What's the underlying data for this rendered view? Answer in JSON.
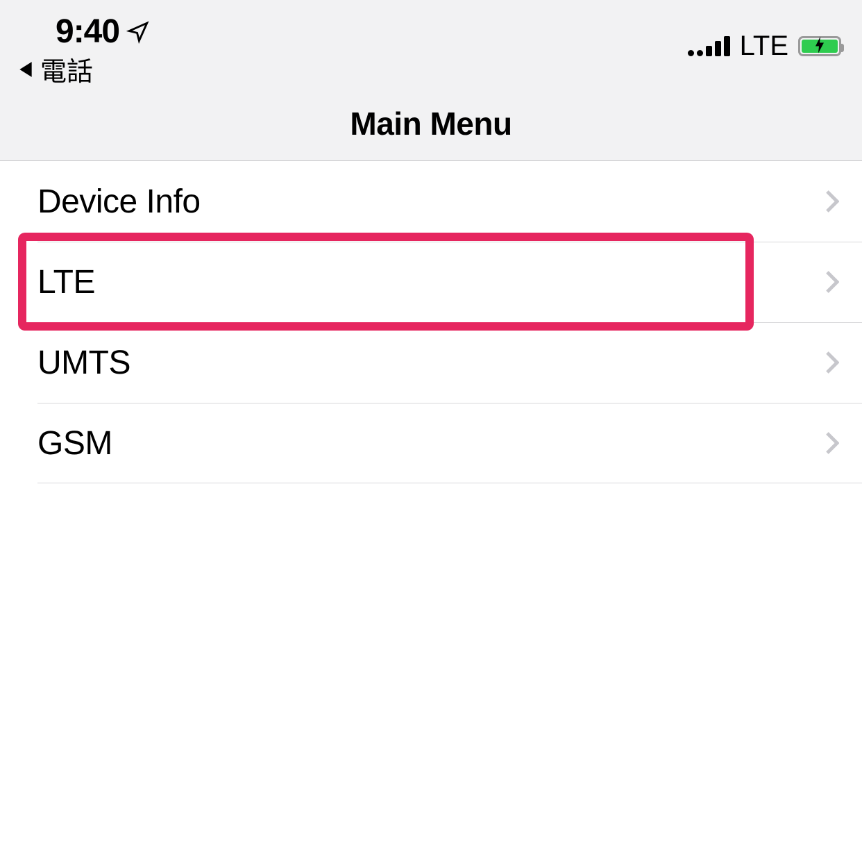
{
  "statusbar": {
    "time": "9:40",
    "network_label": "LTE",
    "back_app_label": "電話"
  },
  "header": {
    "title": "Main Menu"
  },
  "menu": {
    "items": [
      {
        "label": "Device Info"
      },
      {
        "label": "LTE"
      },
      {
        "label": "UMTS"
      },
      {
        "label": "GSM"
      }
    ]
  },
  "highlight": {
    "color": "#e6265f",
    "item_index": 1
  }
}
